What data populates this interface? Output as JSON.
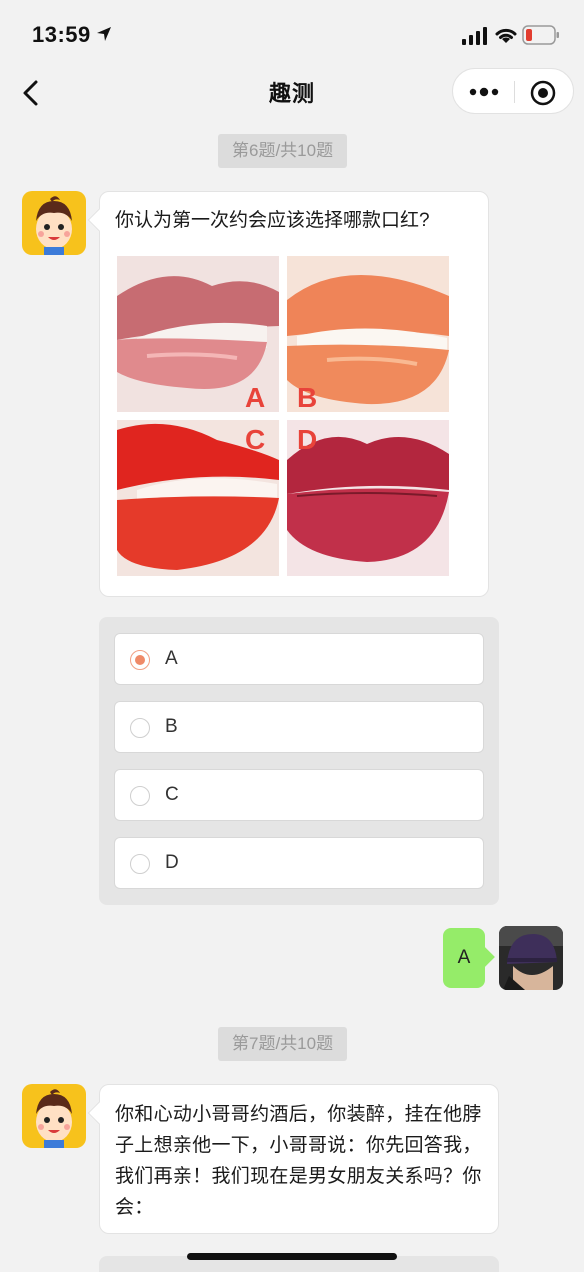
{
  "status_bar": {
    "time": "13:59"
  },
  "nav": {
    "title": "趣测"
  },
  "chat": [
    {
      "tag": "第6题/共10题",
      "question": "你认为第一次约会应该选择哪款口红?",
      "image_labels": [
        "A",
        "B",
        "C",
        "D"
      ],
      "options": [
        "A",
        "B",
        "C",
        "D"
      ],
      "selected": "A",
      "answer": "A"
    },
    {
      "tag": "第7题/共10题",
      "question": "你和心动小哥哥约酒后，你装醉，挂在他脖子上想亲他一下，小哥哥说：你先回答我，我们再亲！我们现在是男女朋友关系吗？你会："
    }
  ],
  "colors": {
    "accent_radio": "#ef8a68",
    "user_bubble": "#95ec69",
    "tag_bg": "#dcdcdc",
    "page_bg": "#f2f2f2"
  },
  "icons": [
    "location-arrow-icon",
    "signal-icon",
    "wifi-icon",
    "battery-low-icon",
    "back-icon",
    "more-icon",
    "target-icon"
  ]
}
